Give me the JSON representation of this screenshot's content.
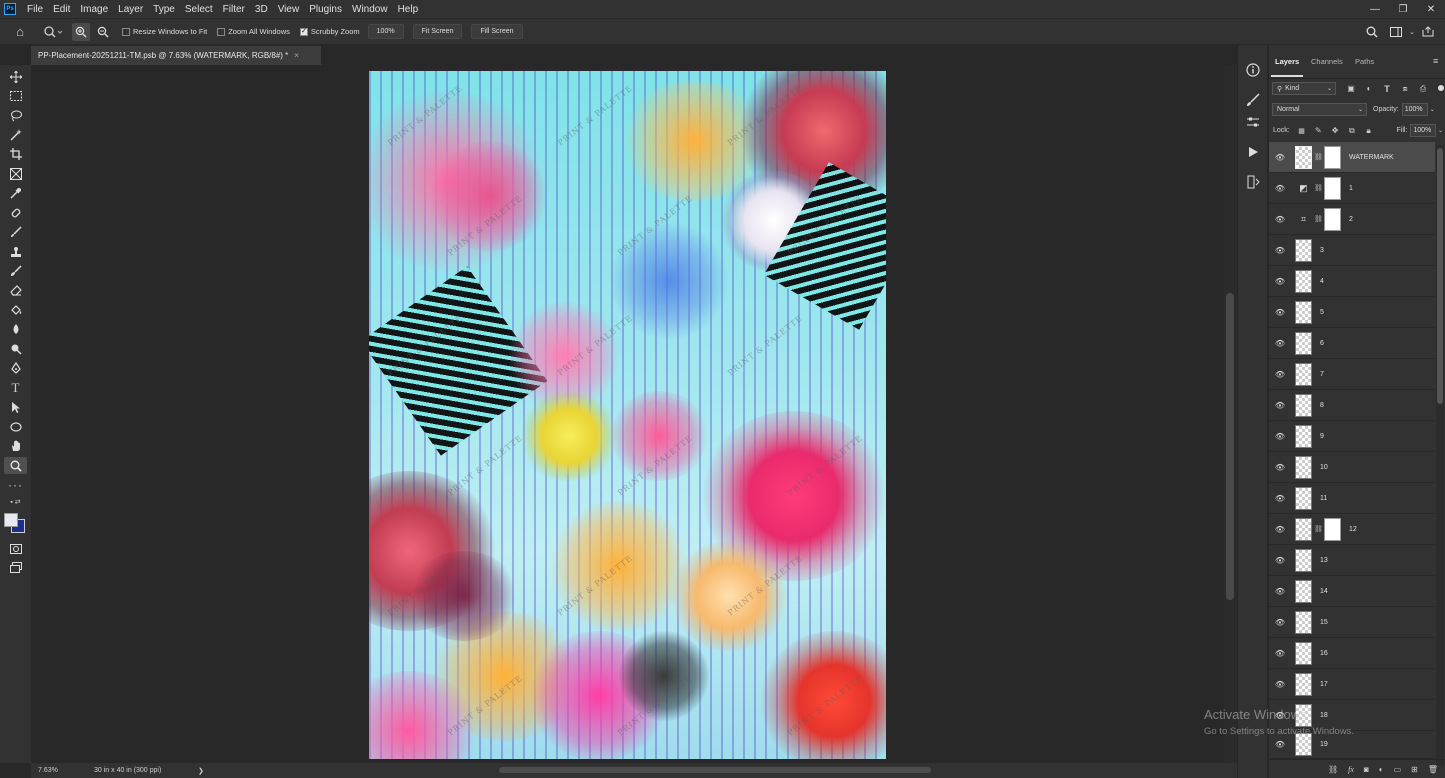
{
  "app": {
    "logo": "Ps"
  },
  "menu": [
    "File",
    "Edit",
    "Image",
    "Layer",
    "Type",
    "Select",
    "Filter",
    "3D",
    "View",
    "Plugins",
    "Window",
    "Help"
  ],
  "window_controls": {
    "minimize": "—",
    "restore": "❐",
    "close": "✕"
  },
  "options_bar": {
    "resize_windows_label": "Resize Windows to Fit",
    "resize_windows_checked": false,
    "zoom_all_label": "Zoom All Windows",
    "zoom_all_checked": false,
    "scrubby_zoom_label": "Scrubby Zoom",
    "scrubby_zoom_checked": true,
    "zoom_value": "100%",
    "fit_screen": "Fit Screen",
    "fill_screen": "Fill Screen"
  },
  "document_tab": {
    "title": "PP-Placement-20251211-TM.psb @ 7.63% (WATERMARK, RGB/8#) *",
    "close": "×"
  },
  "watermark_text": "PRINT & PALETTE",
  "status_bar": {
    "zoom": "7.63%",
    "doc_size": "30 in x 40 in (300 ppi)",
    "arrow": "❯"
  },
  "layers_panel": {
    "tabs": [
      "Layers",
      "Channels",
      "Paths"
    ],
    "active_tab": "Layers",
    "filter_kind": "Kind",
    "blend_mode": "Normal",
    "opacity_label": "Opacity:",
    "opacity_value": "100%",
    "lock_label": "Lock:",
    "fill_label": "Fill:",
    "fill_value": "100%",
    "layers": [
      {
        "name": "WATERMARK",
        "type": "smart",
        "mask": true,
        "selected": true
      },
      {
        "name": "1",
        "type": "adjust-levels",
        "mask": true
      },
      {
        "name": "2",
        "type": "adjust-curves",
        "mask": true
      },
      {
        "name": "3",
        "type": "pixel"
      },
      {
        "name": "4",
        "type": "pixel"
      },
      {
        "name": "5",
        "type": "pixel"
      },
      {
        "name": "6",
        "type": "pixel"
      },
      {
        "name": "7",
        "type": "pixel"
      },
      {
        "name": "8",
        "type": "pixel"
      },
      {
        "name": "9",
        "type": "pixel"
      },
      {
        "name": "10",
        "type": "pixel"
      },
      {
        "name": "11",
        "type": "pixel"
      },
      {
        "name": "12",
        "type": "pixel",
        "mask": true
      },
      {
        "name": "13",
        "type": "pixel"
      },
      {
        "name": "14",
        "type": "pixel"
      },
      {
        "name": "15",
        "type": "pixel"
      },
      {
        "name": "16",
        "type": "pixel"
      },
      {
        "name": "17",
        "type": "pixel"
      },
      {
        "name": "18",
        "type": "pixel"
      },
      {
        "name": "19",
        "type": "pixel"
      }
    ]
  },
  "activation_notice": {
    "title": "Activate Windows",
    "subtitle": "Go to Settings to activate Windows."
  }
}
